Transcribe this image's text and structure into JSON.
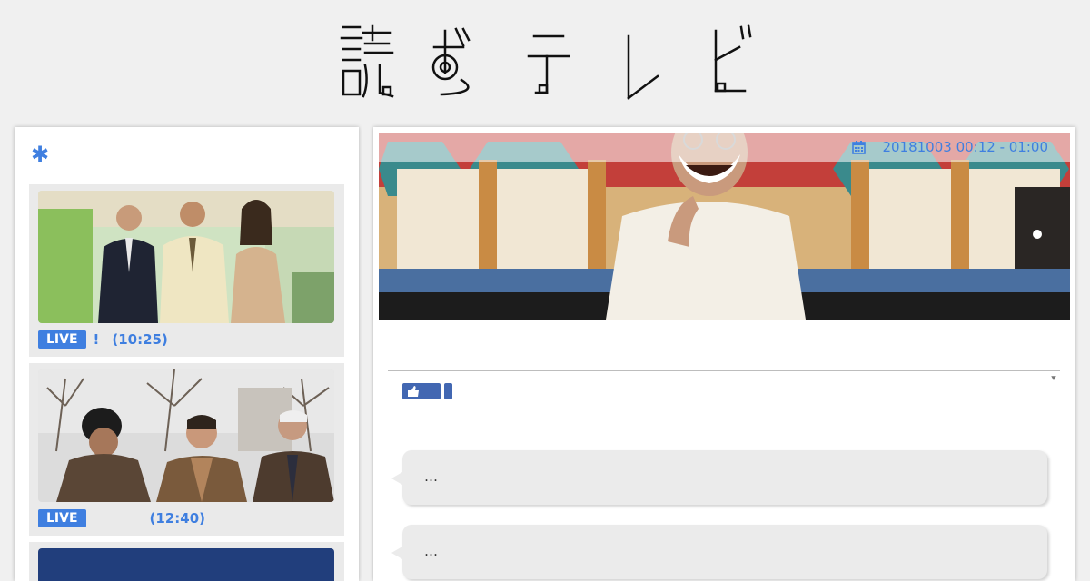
{
  "logo": {
    "title": "読む テレビ"
  },
  "sidebar": {
    "header_icon": "✱",
    "programs": [
      {
        "badge": "LIVE",
        "title": "!",
        "time": "(10:25)"
      },
      {
        "badge": "LIVE",
        "title": "",
        "time": "(12:40)"
      },
      {
        "badge": "",
        "title": "",
        "time": ""
      }
    ]
  },
  "main": {
    "airtime": "20181003 00:12 - 01:00",
    "calendar_icon": "calendar-icon",
    "comments": [
      {
        "text": "…"
      },
      {
        "text": "…"
      }
    ]
  },
  "colors": {
    "accent": "#3f7fe0",
    "facebook": "#4267b2",
    "background": "#f0f0f0"
  }
}
